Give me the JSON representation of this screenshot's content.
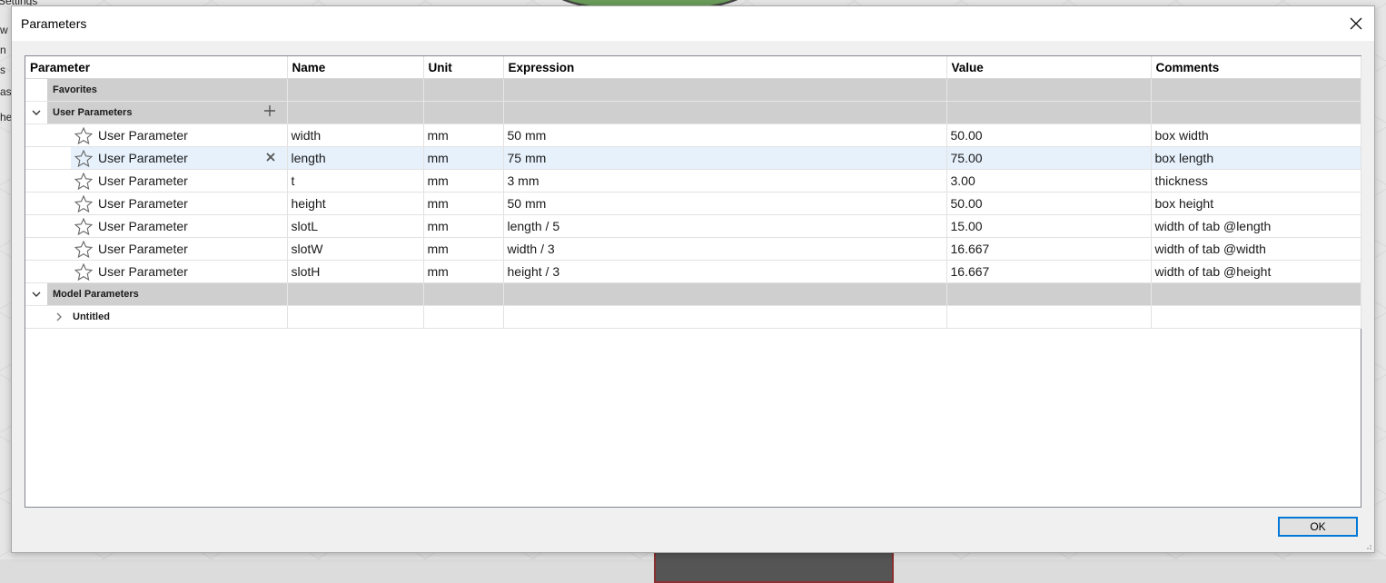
{
  "background": {
    "side_labels": [
      "Settings",
      "w",
      "n",
      "s",
      "as",
      "he"
    ]
  },
  "dialog": {
    "title": "Parameters",
    "ok_label": "OK"
  },
  "columns": [
    "Parameter",
    "Name",
    "Unit",
    "Expression",
    "Value",
    "Comments"
  ],
  "groups": {
    "favorites": "Favorites",
    "user": "User Parameters",
    "model": "Model Parameters",
    "untitled": "Untitled"
  },
  "rows": [
    {
      "type": "User Parameter",
      "name": "width",
      "unit": "mm",
      "expression": "50 mm",
      "value": "50.00",
      "comment": "box width"
    },
    {
      "type": "User Parameter",
      "name": "length",
      "unit": "mm",
      "expression": "75 mm",
      "value": "75.00",
      "comment": "box length"
    },
    {
      "type": "User Parameter",
      "name": "t",
      "unit": "mm",
      "expression": "3 mm",
      "value": "3.00",
      "comment": "thickness"
    },
    {
      "type": "User Parameter",
      "name": "height",
      "unit": "mm",
      "expression": "50 mm",
      "value": "50.00",
      "comment": "box height"
    },
    {
      "type": "User Parameter",
      "name": "slotL",
      "unit": "mm",
      "expression": "length / 5",
      "value": "15.00",
      "comment": "width of tab @length"
    },
    {
      "type": "User Parameter",
      "name": "slotW",
      "unit": "mm",
      "expression": "width / 3",
      "value": "16.667",
      "comment": "width of tab @width"
    },
    {
      "type": "User Parameter",
      "name": "slotH",
      "unit": "mm",
      "expression": "height / 3",
      "value": "16.667",
      "comment": "width of tab @height"
    }
  ],
  "selected_row": 1,
  "colors": {
    "group_bg": "#cfcfcf",
    "selected_bg": "#e6f1fc",
    "ok_border": "#0078d7"
  }
}
